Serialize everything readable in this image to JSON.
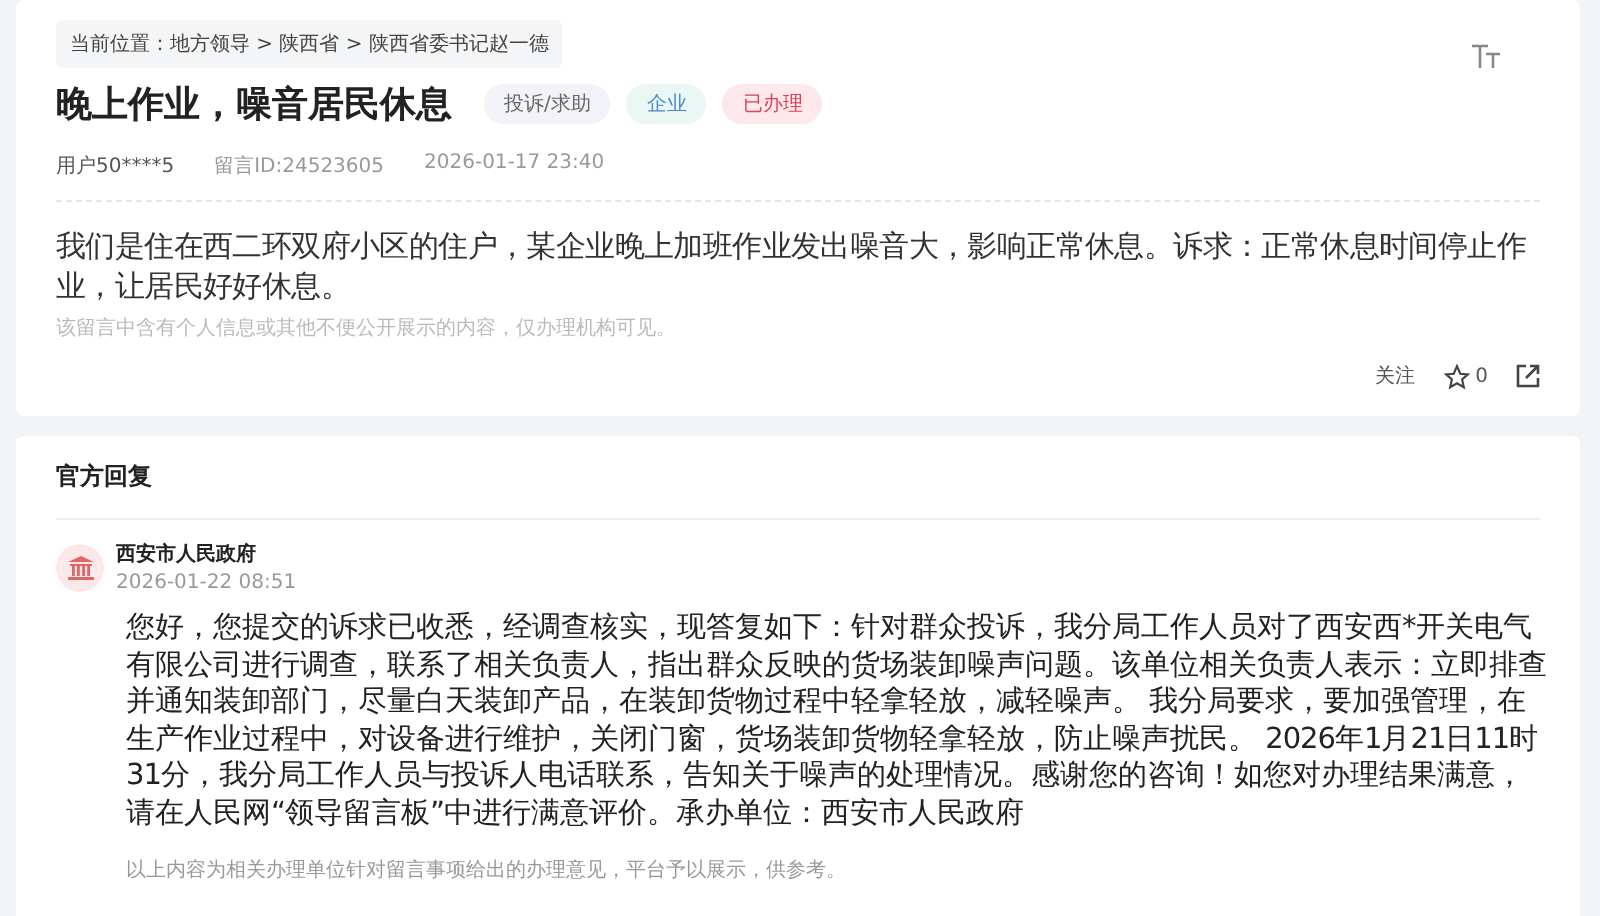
{
  "breadcrumb": "当前位置：地方领导 > 陕西省 > 陕西省委书记赵一德",
  "title": "晚上作业，噪音居民休息",
  "tags": [
    {
      "label": "投诉/求助",
      "kind": "type"
    },
    {
      "label": "企业",
      "kind": "field"
    },
    {
      "label": "已办理",
      "kind": "status"
    }
  ],
  "meta": {
    "user": "用户50****5",
    "message_id": "留言ID:24523605",
    "time": "2026-01-17 23:40"
  },
  "body": "我们是住在西二环双府小区的住户，某企业晚上加班作业发出噪音大，影响正常休息。诉求：正常休息时间停止作业，让居民好好休息。",
  "privacy_note": "该留言中含有个人信息或其他不便公开展示的内容，仅办理机构可见。",
  "actions": {
    "follow": "关注",
    "likes": "0"
  },
  "reply": {
    "heading": "官方回复",
    "org": "西安市人民政府",
    "time": "2026-01-22 08:51",
    "text": "您好，您提交的诉求已收悉，经调查核实，现答复如下：针对群众投诉，我分局工作人员对了西安西*开关电气有限公司进行调查，联系了相关负责人，指出群众反映的货场装卸噪声问题。该单位相关负责人表示：立即排查并通知装卸部门，尽量白天装卸产品，在装卸货物过程中轻拿轻放，减轻噪声。 我分局要求，要加强管理，在生产作业过程中，对设备进行维护，关闭门窗，货场装卸货物轻拿轻放，防止噪声扰民。 2026年1月21日11时31分，我分局工作人员与投诉人电话联系，告知关于噪声的处理情况。感谢您的咨询！如您对办理结果满意，请在人民网“领导留言板”中进行满意评价。承办单位：西安市人民政府",
    "footnote": "以上内容为相关办理单位针对留言事项给出的办理意见，平台予以展示，供参考。"
  }
}
